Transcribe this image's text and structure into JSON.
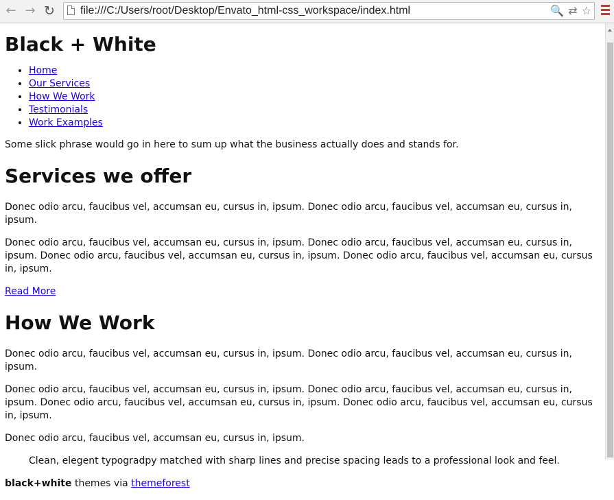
{
  "browser": {
    "back_icon": "←",
    "forward_icon": "→",
    "reload_icon": "↻",
    "url": "file:///C:/Users/root/Desktop/Envato_html-css_workspace/index.html",
    "search_icon": "🔍",
    "translate_icon": "⇄",
    "bookmark_icon": "☆"
  },
  "site": {
    "title": "Black + White",
    "nav": [
      "Home",
      "Our Services",
      "How We Work",
      "Testimonials",
      "Work Examples"
    ],
    "tagline": "Some slick phrase would go in here to sum up what the business actually does and stands for."
  },
  "services": {
    "heading": "Services we offer",
    "paragraph_1": "Donec odio arcu, faucibus vel, accumsan eu, cursus in, ipsum. Donec odio arcu, faucibus vel, accumsan eu, cursus in, ipsum.",
    "paragraph_2": "Donec odio arcu, faucibus vel, accumsan eu, cursus in, ipsum. Donec odio arcu, faucibus vel, accumsan eu, cursus in, ipsum. Donec odio arcu, faucibus vel, accumsan eu, cursus in, ipsum. Donec odio arcu, faucibus vel, accumsan eu, cursus in, ipsum.",
    "read_more": "Read More"
  },
  "how_we_work": {
    "heading": "How We Work",
    "paragraph_1": "Donec odio arcu, faucibus vel, accumsan eu, cursus in, ipsum. Donec odio arcu, faucibus vel, accumsan eu, cursus in, ipsum.",
    "paragraph_2": "Donec odio arcu, faucibus vel, accumsan eu, cursus in, ipsum. Donec odio arcu, faucibus vel, accumsan eu, cursus in, ipsum. Donec odio arcu, faucibus vel, accumsan eu, cursus in, ipsum. Donec odio arcu, faucibus vel, accumsan eu, cursus in, ipsum.",
    "paragraph_3": "Donec odio arcu, faucibus vel, accumsan eu, cursus in, ipsum.",
    "quote": "Clean, elegent typogradpy matched with sharp lines and precise spacing leads to a professional look and feel."
  },
  "footer": {
    "brand": "black+white",
    "text": " themes via ",
    "link": "themeforest"
  }
}
